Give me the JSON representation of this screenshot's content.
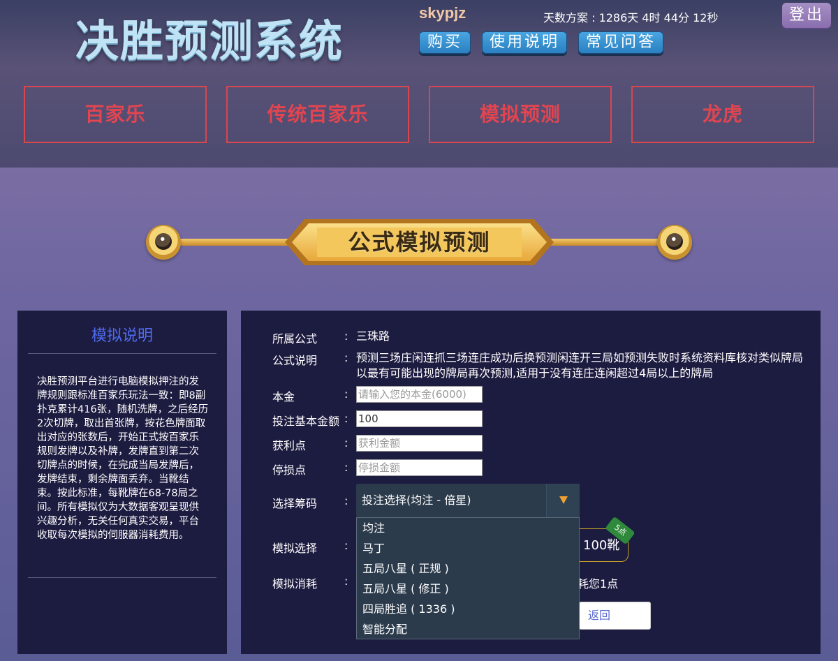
{
  "header": {
    "logo": "决胜预测系统",
    "username": "skypjz",
    "countdown": "天数方案 : 1286天 4时 44分 12秒",
    "logout": "登出",
    "buttons": [
      "购买",
      "使用说明",
      "常见问答"
    ]
  },
  "nav": {
    "tabs": [
      "百家乐",
      "传统百家乐",
      "模拟预测",
      "龙虎"
    ]
  },
  "banner": {
    "title": "公式模拟预测"
  },
  "left_panel": {
    "title": "模拟说明",
    "body": "决胜预测平台进行电脑模拟押注的发牌规则跟标准百家乐玩法一致：即8副扑克累计416张，随机洗牌，之后经历2次切牌，取出首张牌，按花色牌面取出对应的张数后，开始正式按百家乐规则发牌以及补牌，发牌直到第二次切牌点的时候，在完成当局发牌后，发牌结束，剩余牌面丢弃。当靴结束。按此标准，每靴牌在68-78局之间。所有模拟仅为大数据客观呈现供兴趣分析，无关任何真实交易，平台收取每次模拟的伺服器消耗费用。"
  },
  "form": {
    "colon": ":",
    "formula_label": "所属公式",
    "formula_value": "三珠路",
    "desc_label": "公式说明",
    "desc_value": "预测三场庄闲连抓三场连庄成功后换预测闲连开三局如预测失败时系统资料库核对类似牌局以最有可能出现的牌局再次预测,适用于没有连庄连闲超过4局以上的牌局",
    "capital_label": "本金",
    "capital_placeholder": "请输入您的本金(6000)",
    "base_label": "投注基本金额",
    "base_value": "100",
    "profit_label": "获利点",
    "profit_placeholder": "获利金额",
    "stop_label": "停损点",
    "stop_placeholder": "停损金额",
    "chip_label": "选择筹码",
    "chip_selected": "投注选择(均注 - 倍星)",
    "chip_options": [
      "均注",
      "马丁",
      "五局八星 ( 正规 )",
      "五局八星 ( 修正 )",
      "四局胜追 ( 1336 )",
      "智能分配"
    ],
    "sim_label": "模拟选择",
    "boot_value": "100靴",
    "boot_badge": "5点",
    "consume_label": "模拟消耗",
    "consume_value": "耗您1点",
    "back_button": "返回"
  },
  "colors": {
    "nav_red": "#e24550",
    "panel_bg": "#1c1b40",
    "left_title": "#4f6df0",
    "dropdown_bg": "#2b3b4c",
    "arrow": "#f0a030"
  }
}
